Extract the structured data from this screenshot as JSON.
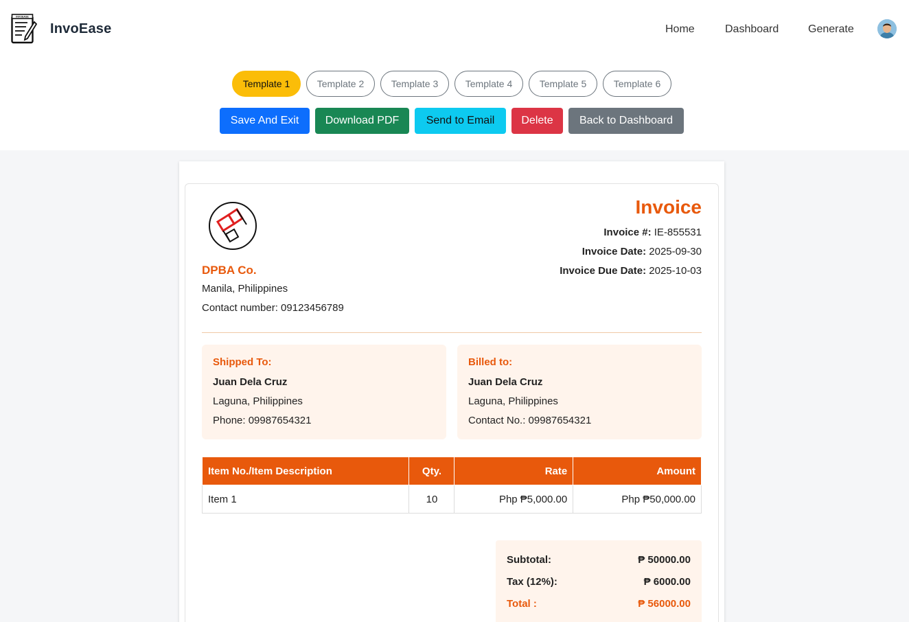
{
  "brand": {
    "name": "InvoEase",
    "logo_label": "INVOEASE"
  },
  "nav": {
    "home": "Home",
    "dashboard": "Dashboard",
    "generate": "Generate"
  },
  "templates": [
    "Template 1",
    "Template 2",
    "Template 3",
    "Template 4",
    "Template 5",
    "Template 6"
  ],
  "active_template": "Template 1",
  "actions": {
    "save": "Save And Exit",
    "pdf": "Download PDF",
    "email": "Send to Email",
    "delete": "Delete",
    "back": "Back to Dashboard"
  },
  "company": {
    "name": "DPBA Co.",
    "address": "Manila, Philippines",
    "contact": "Contact number: 09123456789"
  },
  "invoice": {
    "title": "Invoice",
    "number_label": "Invoice #:",
    "number": "IE-855531",
    "date_label": "Invoice Date:",
    "date": "2025-09-30",
    "due_label": "Invoice Due Date:",
    "due": "2025-10-03"
  },
  "shipped_to": {
    "heading": "Shipped To:",
    "name": "Juan Dela Cruz",
    "location": "Laguna, Philippines",
    "phone": "Phone: 09987654321"
  },
  "billed_to": {
    "heading": "Billed to:",
    "name": "Juan Dela Cruz",
    "location": "Laguna, Philippines",
    "phone": "Contact No.: 09987654321"
  },
  "table": {
    "headers": [
      "Item No./Item Description",
      "Qty.",
      "Rate",
      "Amount"
    ],
    "rows": [
      [
        "Item 1",
        "10",
        "Php ₱5,000.00",
        "Php ₱50,000.00"
      ]
    ]
  },
  "totals": {
    "subtotal_label": "Subtotal:",
    "subtotal": "₱ 50000.00",
    "tax_label": "Tax (12%):",
    "tax": "₱ 6000.00",
    "total_label": "Total :",
    "total": "₱ 56000.00"
  },
  "colors": {
    "accent": "#e8590c",
    "active_template": "#fbbd08",
    "save": "#0d6efd",
    "pdf": "#198754",
    "email": "#0dcaf0",
    "delete": "#dc3545",
    "back": "#6c757d",
    "panel": "#fff4ec"
  },
  "icons": {
    "brand": "invoice-notepad-icon",
    "avatar": "user-avatar",
    "company_logo": "company-logo"
  }
}
